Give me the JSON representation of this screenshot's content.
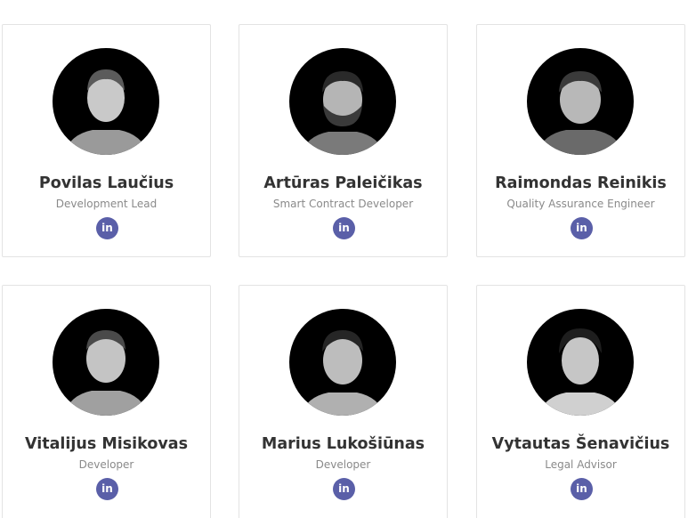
{
  "accent_color": "#5a5fa8",
  "team": [
    {
      "name": "Povilas Laučius",
      "role": "Development Lead",
      "linkedin_icon": "linkedin-icon",
      "linkedin_text": "in"
    },
    {
      "name": "Artūras Paleičikas",
      "role": "Smart Contract Developer",
      "linkedin_icon": "linkedin-icon",
      "linkedin_text": "in"
    },
    {
      "name": "Raimondas Reinikis",
      "role": "Quality Assurance Engineer",
      "linkedin_icon": "linkedin-icon",
      "linkedin_text": "in"
    },
    {
      "name": "Vitalijus Misikovas",
      "role": "Developer",
      "linkedin_icon": "linkedin-icon",
      "linkedin_text": "in"
    },
    {
      "name": "Marius Lukošiūnas",
      "role": "Developer",
      "linkedin_icon": "linkedin-icon",
      "linkedin_text": "in"
    },
    {
      "name": "Vytautas Šenavičius",
      "role": "Legal Advisor",
      "linkedin_icon": "linkedin-icon",
      "linkedin_text": "in"
    }
  ]
}
